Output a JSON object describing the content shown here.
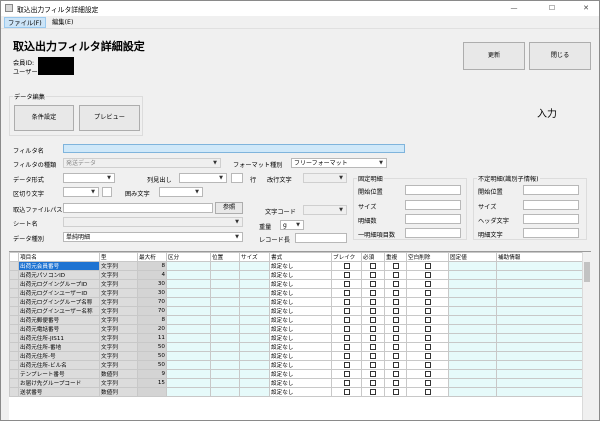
{
  "window": {
    "title": "取込出力フィルタ詳細設定",
    "minimize": "—",
    "maximize": "☐",
    "close": "✕"
  },
  "menu": {
    "file": "ファイル(F)",
    "edit": "編集(E)"
  },
  "header": {
    "title": "取込出力フィルタ詳細設定",
    "member_label": "会員ID:",
    "user_label": "ユーザー:",
    "update_button": "更新",
    "close_button": "閉じる",
    "mode": "入力"
  },
  "data_edit": {
    "group_label": "データ編集",
    "condition_button": "条件設定",
    "preview_button": "プレビュー"
  },
  "form": {
    "filter_name_label": "フィルタ名",
    "filter_name_value": "",
    "filter_type_label": "フィルタの種類",
    "filter_type_value": "発送データ",
    "format_type_label": "フォーマット種別",
    "format_type_value": "フリーフォーマット",
    "data_format_label": "データ形式",
    "column_header_label": "列見出し",
    "row_label": "行",
    "newline_label": "改行文字",
    "delimiter_label": "区切り文字",
    "enclosure_label": "囲み文字",
    "import_path_label": "取込ファイルパス",
    "browse_button": "参照",
    "char_code_label": "文字コード",
    "sheet_name_label": "シート名",
    "weight_label": "重量",
    "weight_value": "g",
    "data_kind_label": "データ種別",
    "data_kind_value": "単純明細",
    "record_length_label": "レコード長"
  },
  "fixed_detail": {
    "title": "固定明細",
    "start_label": "開始位置",
    "size_label": "サイズ",
    "count_label": "明細数",
    "line_items_label": "一明細項目数"
  },
  "variable_detail": {
    "title": "不定明細(識別子情報)",
    "start_label": "開始位置",
    "size_label": "サイズ",
    "header_char_label": "ヘッダ文字",
    "detail_char_label": "明細文字"
  },
  "table": {
    "columns": [
      "項目名",
      "型",
      "最大桁",
      "区分",
      "位置",
      "サイズ",
      "書式",
      "ブレイク",
      "必須",
      "重複",
      "空白削除",
      "固定値",
      "補助情報"
    ],
    "rows": [
      {
        "name": "出荷元会員番号",
        "type": "文字列",
        "max": "8",
        "format": "設定なし"
      },
      {
        "name": "出荷元パソコンID",
        "type": "文字列",
        "max": "4",
        "format": "設定なし"
      },
      {
        "name": "出荷元ログイングループID",
        "type": "文字列",
        "max": "30",
        "format": "設定なし"
      },
      {
        "name": "出荷元ログインユーザーID",
        "type": "文字列",
        "max": "30",
        "format": "設定なし"
      },
      {
        "name": "出荷元ログイングループ名称",
        "type": "文字列",
        "max": "70",
        "format": "設定なし"
      },
      {
        "name": "出荷元ログインユーザー名称",
        "type": "文字列",
        "max": "70",
        "format": "設定なし"
      },
      {
        "name": "出荷元郵便番号",
        "type": "文字列",
        "max": "8",
        "format": "設定なし"
      },
      {
        "name": "出荷元電話番号",
        "type": "文字列",
        "max": "20",
        "format": "設定なし"
      },
      {
        "name": "出荷元住所-JIS11",
        "type": "文字列",
        "max": "11",
        "format": "設定なし"
      },
      {
        "name": "出荷元住所-番地",
        "type": "文字列",
        "max": "50",
        "format": "設定なし"
      },
      {
        "name": "出荷元住所-号",
        "type": "文字列",
        "max": "50",
        "format": "設定なし"
      },
      {
        "name": "出荷元住所-ビル名",
        "type": "文字列",
        "max": "50",
        "format": "設定なし"
      },
      {
        "name": "テンプレート番号",
        "type": "数値列",
        "max": "9",
        "format": "設定なし"
      },
      {
        "name": "お届け先グループコード",
        "type": "文字列",
        "max": "15",
        "format": "設定なし"
      },
      {
        "name": "送状番号",
        "type": "数値列",
        "max": "",
        "format": "設定なし"
      }
    ]
  }
}
